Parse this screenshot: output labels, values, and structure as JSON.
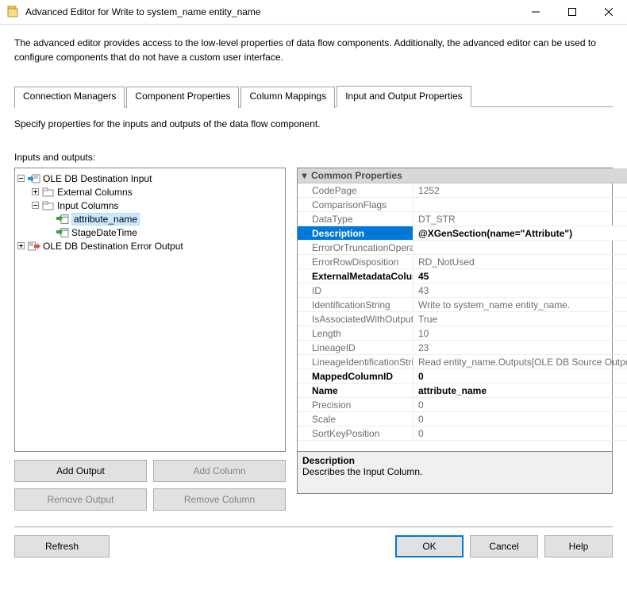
{
  "window": {
    "title": "Advanced Editor for Write to system_name entity_name"
  },
  "description": "The advanced editor provides access to the low-level properties of data flow components. Additionally, the advanced editor can be used to configure components that do not have a custom user interface.",
  "tabs": {
    "t0": "Connection Managers",
    "t1": "Component Properties",
    "t2": "Column Mappings",
    "t3": "Input and Output Properties"
  },
  "panel": {
    "intro": "Specify properties for the inputs and outputs of the data flow component.",
    "ioLabel": "Inputs and outputs:"
  },
  "tree": {
    "n0": "OLE DB Destination Input",
    "n1": "External Columns",
    "n2": "Input Columns",
    "n3": "attribute_name",
    "n4": "StageDateTime",
    "n5": "OLE DB Destination Error Output"
  },
  "propCat": "Common Properties",
  "props": [
    {
      "name": "CodePage",
      "value": "1252",
      "bold": false
    },
    {
      "name": "ComparisonFlags",
      "value": "",
      "bold": false
    },
    {
      "name": "DataType",
      "value": "DT_STR",
      "bold": false
    },
    {
      "name": "Description",
      "value": "@XGenSection(name=\"Attribute\")",
      "bold": false,
      "sel": true
    },
    {
      "name": "ErrorOrTruncationOperation",
      "value": "",
      "bold": false
    },
    {
      "name": "ErrorRowDisposition",
      "value": "RD_NotUsed",
      "bold": false
    },
    {
      "name": "ExternalMetadataColumnID",
      "value": "45",
      "bold": true
    },
    {
      "name": "ID",
      "value": "43",
      "bold": false
    },
    {
      "name": "IdentificationString",
      "value": "Write to system_name entity_name.",
      "bold": false
    },
    {
      "name": "IsAssociatedWithOutputColumn",
      "value": "True",
      "bold": false
    },
    {
      "name": "Length",
      "value": "10",
      "bold": false
    },
    {
      "name": "LineageID",
      "value": "23",
      "bold": false
    },
    {
      "name": "LineageIdentificationString",
      "value": "Read entity_name.Outputs[OLE DB Source Output]",
      "bold": false
    },
    {
      "name": "MappedColumnID",
      "value": "0",
      "bold": true
    },
    {
      "name": "Name",
      "value": "attribute_name",
      "bold": true
    },
    {
      "name": "Precision",
      "value": "0",
      "bold": false
    },
    {
      "name": "Scale",
      "value": "0",
      "bold": false
    },
    {
      "name": "SortKeyPosition",
      "value": "0",
      "bold": false
    }
  ],
  "desc": {
    "title": "Description",
    "text": "Describes the Input Column."
  },
  "buttons": {
    "addOutput": "Add Output",
    "addColumn": "Add Column",
    "removeOutput": "Remove Output",
    "removeColumn": "Remove Column",
    "refresh": "Refresh",
    "ok": "OK",
    "cancel": "Cancel",
    "help": "Help"
  }
}
